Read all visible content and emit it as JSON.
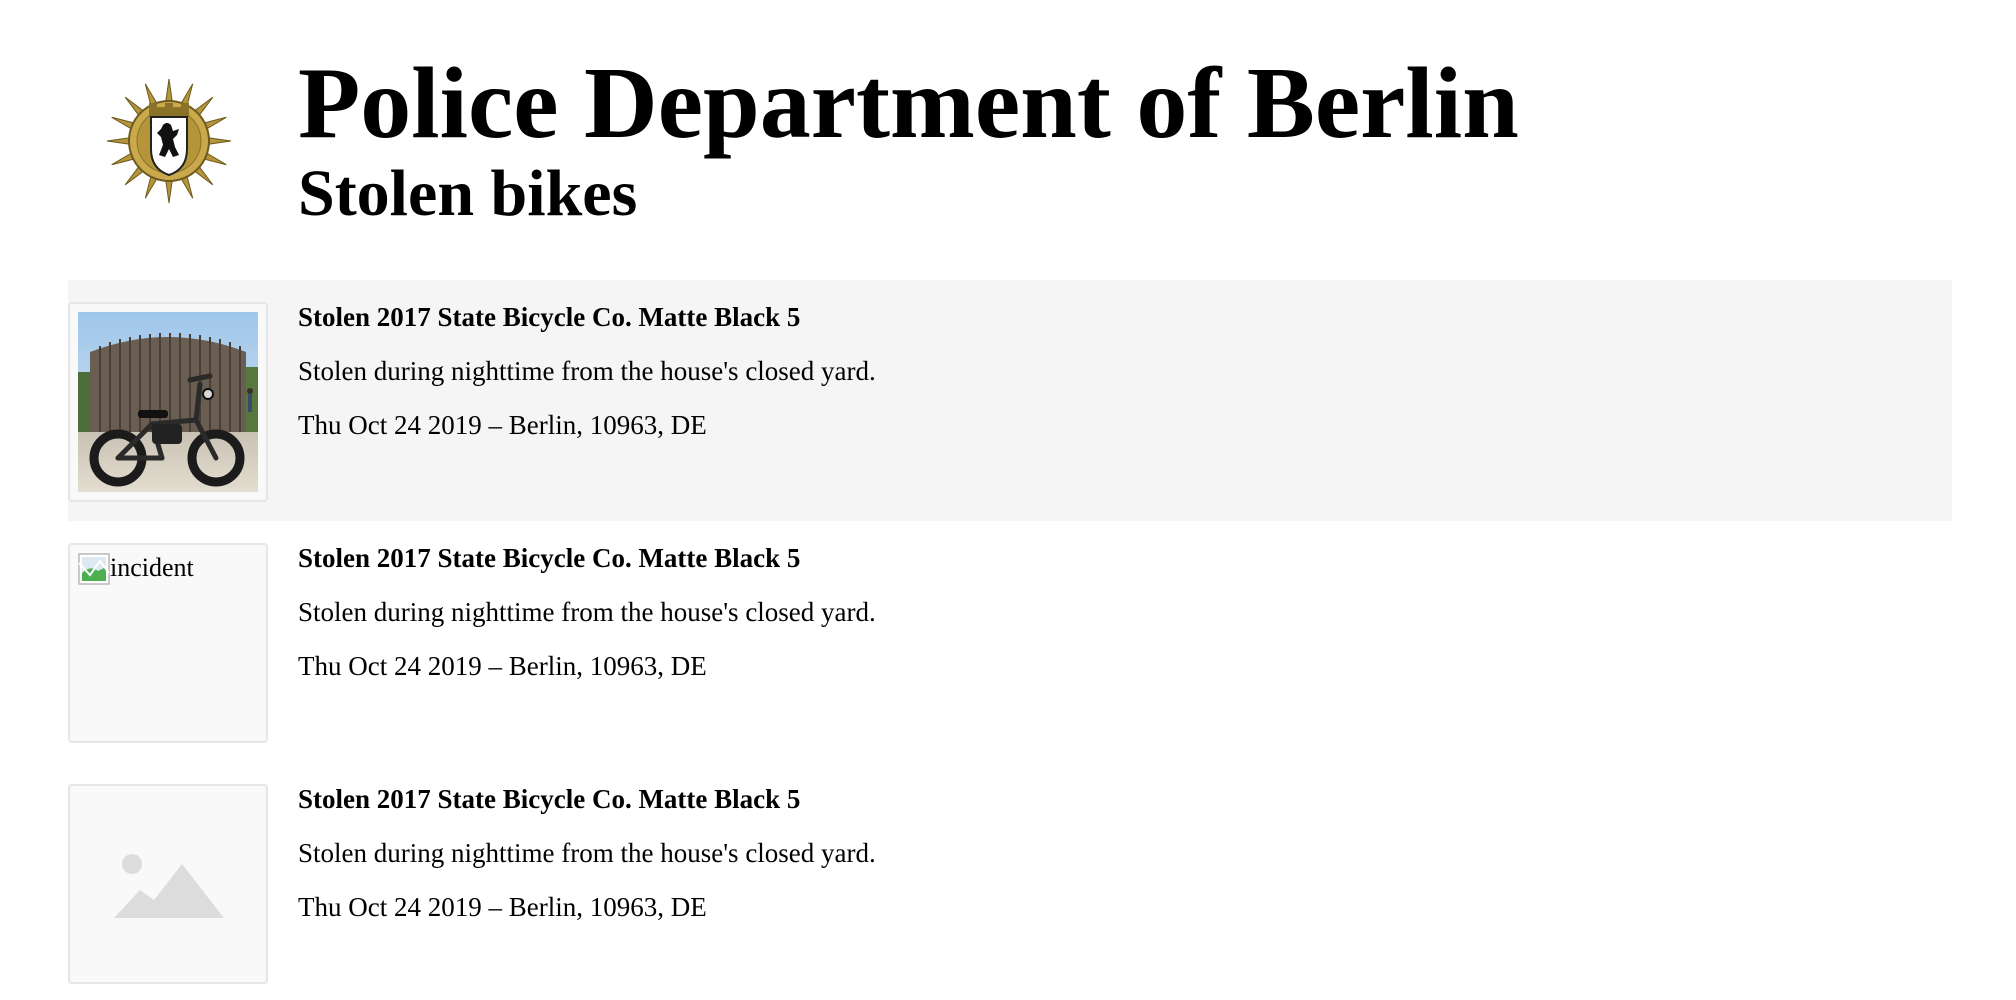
{
  "header": {
    "logo_icon": "berlin-police-star-icon",
    "title": "Police Department of Berlin",
    "subtitle": "Stolen bikes"
  },
  "incidents": [
    {
      "title": "Stolen 2017 State Bicycle Co. Matte Black 5",
      "description": "Stolen during nighttime from the house's closed yard.",
      "meta": "Thu Oct 24 2019 – Berlin, 10963, DE",
      "image_state": "photo",
      "image_icon": "bike-photo"
    },
    {
      "title": "Stolen 2017 State Bicycle Co. Matte Black 5",
      "description": "Stolen during nighttime from the house's closed yard.",
      "meta": "Thu Oct 24 2019 – Berlin, 10963, DE",
      "image_state": "broken",
      "image_icon": "broken-image-icon",
      "image_alt": "incident"
    },
    {
      "title": "Stolen 2017 State Bicycle Co. Matte Black 5",
      "description": "Stolen during nighttime from the house's closed yard.",
      "meta": "Thu Oct 24 2019 – Berlin, 10963, DE",
      "image_state": "placeholder",
      "image_icon": "image-placeholder-icon"
    }
  ],
  "colors": {
    "highlight_row": "#f5f5f5",
    "thumb_border": "#e6e6e6",
    "thumb_bg": "#f9f9f9",
    "placeholder_art": "#dcdcdc",
    "badge_gold": "#b4953a"
  }
}
